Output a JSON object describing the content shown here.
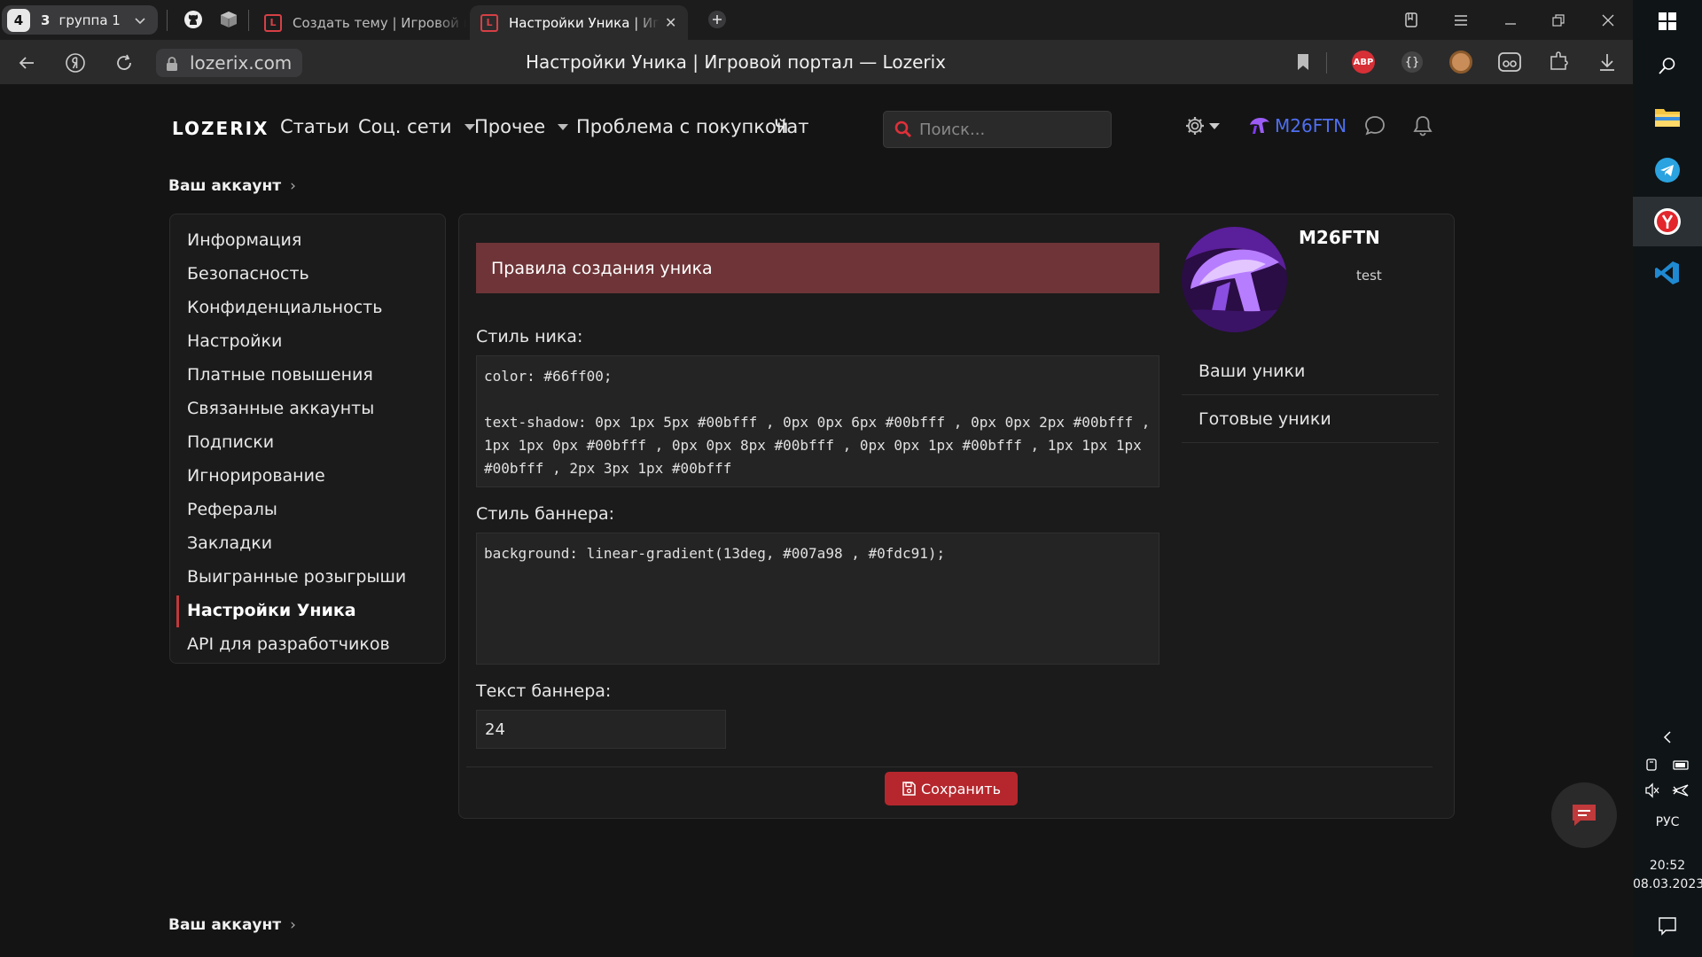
{
  "browser": {
    "group": {
      "count": "4",
      "tabs_in_group": "3",
      "label": "группа 1"
    },
    "tabs": [
      {
        "title": "Создать тему | Игровой портал — Lozerix",
        "favicon": "L"
      },
      {
        "title": "Настройки Уника | Игровой портал — Lozerix",
        "favicon": "L"
      }
    ],
    "url": "lozerix.com",
    "page_title": "Настройки Уника | Игровой портал — Lozerix",
    "ext_abp": "ABP",
    "ext_braces": "{}"
  },
  "site": {
    "logo": "LOZERIX",
    "nav": [
      "Статьи",
      "Соц. сети",
      "Прочее",
      "Проблема с покупкой",
      "Чат"
    ],
    "search_placeholder": "Поиск...",
    "username": "M26FTN"
  },
  "breadcrumb": {
    "label": "Ваш аккаунт",
    "chevron": "›"
  },
  "sidebar": {
    "items": [
      "Информация",
      "Безопасность",
      "Конфиденциальность",
      "Настройки",
      "Платные повышения",
      "Связанные аккаунты",
      "Подписки",
      "Игнорирование",
      "Рефералы",
      "Закладки",
      "Выигранные розыгрыши",
      "Настройки Уника",
      "API для разработчиков"
    ],
    "active_index": 11
  },
  "main": {
    "rules_banner": "Правила создания уника",
    "nick_style_label": "Стиль ника:",
    "nick_style_value": "color: #66ff00;\n\ntext-shadow: 0px 1px 5px #00bfff , 0px 0px 6px #00bfff , 0px 0px 2px #00bfff , 1px 1px 0px #00bfff , 0px 0px 8px #00bfff , 0px 0px 1px #00bfff , 1px 1px 1px #00bfff , 2px 3px 1px #00bfff",
    "banner_style_label": "Стиль баннера:",
    "banner_style_value": "background: linear-gradient(13deg, #007a98 , #0fdc91);",
    "banner_text_label": "Текст баннера:",
    "banner_text_value": "24",
    "save_label": "Сохранить"
  },
  "profile": {
    "name": "M26FTN",
    "status": "test",
    "links": [
      "Ваши уники",
      "Готовые уники"
    ]
  },
  "taskbar": {
    "language": "РУС",
    "time": "20:52",
    "date": "08.03.2023"
  },
  "colors": {
    "accent": "#b5272d",
    "rules_bg": "#6e3437",
    "username": "#4f6ff0"
  }
}
